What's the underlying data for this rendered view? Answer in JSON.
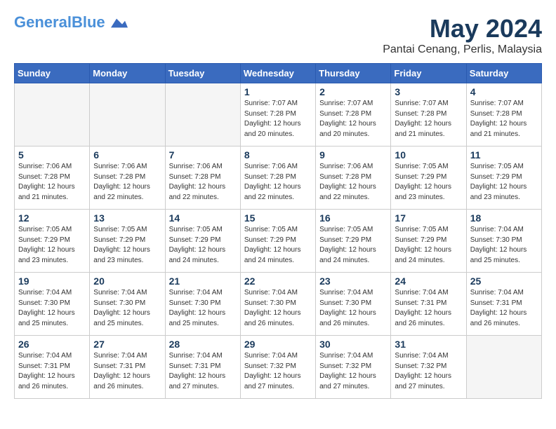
{
  "header": {
    "logo_line1": "General",
    "logo_line2": "Blue",
    "month": "May 2024",
    "location": "Pantai Cenang, Perlis, Malaysia"
  },
  "days_of_week": [
    "Sunday",
    "Monday",
    "Tuesday",
    "Wednesday",
    "Thursday",
    "Friday",
    "Saturday"
  ],
  "weeks": [
    [
      {
        "day": "",
        "sunrise": "",
        "sunset": "",
        "daylight": "",
        "empty": true
      },
      {
        "day": "",
        "sunrise": "",
        "sunset": "",
        "daylight": "",
        "empty": true
      },
      {
        "day": "",
        "sunrise": "",
        "sunset": "",
        "daylight": "",
        "empty": true
      },
      {
        "day": "1",
        "sunrise": "Sunrise: 7:07 AM",
        "sunset": "Sunset: 7:28 PM",
        "daylight": "Daylight: 12 hours and 20 minutes."
      },
      {
        "day": "2",
        "sunrise": "Sunrise: 7:07 AM",
        "sunset": "Sunset: 7:28 PM",
        "daylight": "Daylight: 12 hours and 20 minutes."
      },
      {
        "day": "3",
        "sunrise": "Sunrise: 7:07 AM",
        "sunset": "Sunset: 7:28 PM",
        "daylight": "Daylight: 12 hours and 21 minutes."
      },
      {
        "day": "4",
        "sunrise": "Sunrise: 7:07 AM",
        "sunset": "Sunset: 7:28 PM",
        "daylight": "Daylight: 12 hours and 21 minutes."
      }
    ],
    [
      {
        "day": "5",
        "sunrise": "Sunrise: 7:06 AM",
        "sunset": "Sunset: 7:28 PM",
        "daylight": "Daylight: 12 hours and 21 minutes."
      },
      {
        "day": "6",
        "sunrise": "Sunrise: 7:06 AM",
        "sunset": "Sunset: 7:28 PM",
        "daylight": "Daylight: 12 hours and 22 minutes."
      },
      {
        "day": "7",
        "sunrise": "Sunrise: 7:06 AM",
        "sunset": "Sunset: 7:28 PM",
        "daylight": "Daylight: 12 hours and 22 minutes."
      },
      {
        "day": "8",
        "sunrise": "Sunrise: 7:06 AM",
        "sunset": "Sunset: 7:28 PM",
        "daylight": "Daylight: 12 hours and 22 minutes."
      },
      {
        "day": "9",
        "sunrise": "Sunrise: 7:06 AM",
        "sunset": "Sunset: 7:28 PM",
        "daylight": "Daylight: 12 hours and 22 minutes."
      },
      {
        "day": "10",
        "sunrise": "Sunrise: 7:05 AM",
        "sunset": "Sunset: 7:29 PM",
        "daylight": "Daylight: 12 hours and 23 minutes."
      },
      {
        "day": "11",
        "sunrise": "Sunrise: 7:05 AM",
        "sunset": "Sunset: 7:29 PM",
        "daylight": "Daylight: 12 hours and 23 minutes."
      }
    ],
    [
      {
        "day": "12",
        "sunrise": "Sunrise: 7:05 AM",
        "sunset": "Sunset: 7:29 PM",
        "daylight": "Daylight: 12 hours and 23 minutes."
      },
      {
        "day": "13",
        "sunrise": "Sunrise: 7:05 AM",
        "sunset": "Sunset: 7:29 PM",
        "daylight": "Daylight: 12 hours and 23 minutes."
      },
      {
        "day": "14",
        "sunrise": "Sunrise: 7:05 AM",
        "sunset": "Sunset: 7:29 PM",
        "daylight": "Daylight: 12 hours and 24 minutes."
      },
      {
        "day": "15",
        "sunrise": "Sunrise: 7:05 AM",
        "sunset": "Sunset: 7:29 PM",
        "daylight": "Daylight: 12 hours and 24 minutes."
      },
      {
        "day": "16",
        "sunrise": "Sunrise: 7:05 AM",
        "sunset": "Sunset: 7:29 PM",
        "daylight": "Daylight: 12 hours and 24 minutes."
      },
      {
        "day": "17",
        "sunrise": "Sunrise: 7:05 AM",
        "sunset": "Sunset: 7:29 PM",
        "daylight": "Daylight: 12 hours and 24 minutes."
      },
      {
        "day": "18",
        "sunrise": "Sunrise: 7:04 AM",
        "sunset": "Sunset: 7:30 PM",
        "daylight": "Daylight: 12 hours and 25 minutes."
      }
    ],
    [
      {
        "day": "19",
        "sunrise": "Sunrise: 7:04 AM",
        "sunset": "Sunset: 7:30 PM",
        "daylight": "Daylight: 12 hours and 25 minutes."
      },
      {
        "day": "20",
        "sunrise": "Sunrise: 7:04 AM",
        "sunset": "Sunset: 7:30 PM",
        "daylight": "Daylight: 12 hours and 25 minutes."
      },
      {
        "day": "21",
        "sunrise": "Sunrise: 7:04 AM",
        "sunset": "Sunset: 7:30 PM",
        "daylight": "Daylight: 12 hours and 25 minutes."
      },
      {
        "day": "22",
        "sunrise": "Sunrise: 7:04 AM",
        "sunset": "Sunset: 7:30 PM",
        "daylight": "Daylight: 12 hours and 26 minutes."
      },
      {
        "day": "23",
        "sunrise": "Sunrise: 7:04 AM",
        "sunset": "Sunset: 7:30 PM",
        "daylight": "Daylight: 12 hours and 26 minutes."
      },
      {
        "day": "24",
        "sunrise": "Sunrise: 7:04 AM",
        "sunset": "Sunset: 7:31 PM",
        "daylight": "Daylight: 12 hours and 26 minutes."
      },
      {
        "day": "25",
        "sunrise": "Sunrise: 7:04 AM",
        "sunset": "Sunset: 7:31 PM",
        "daylight": "Daylight: 12 hours and 26 minutes."
      }
    ],
    [
      {
        "day": "26",
        "sunrise": "Sunrise: 7:04 AM",
        "sunset": "Sunset: 7:31 PM",
        "daylight": "Daylight: 12 hours and 26 minutes."
      },
      {
        "day": "27",
        "sunrise": "Sunrise: 7:04 AM",
        "sunset": "Sunset: 7:31 PM",
        "daylight": "Daylight: 12 hours and 26 minutes."
      },
      {
        "day": "28",
        "sunrise": "Sunrise: 7:04 AM",
        "sunset": "Sunset: 7:31 PM",
        "daylight": "Daylight: 12 hours and 27 minutes."
      },
      {
        "day": "29",
        "sunrise": "Sunrise: 7:04 AM",
        "sunset": "Sunset: 7:32 PM",
        "daylight": "Daylight: 12 hours and 27 minutes."
      },
      {
        "day": "30",
        "sunrise": "Sunrise: 7:04 AM",
        "sunset": "Sunset: 7:32 PM",
        "daylight": "Daylight: 12 hours and 27 minutes."
      },
      {
        "day": "31",
        "sunrise": "Sunrise: 7:04 AM",
        "sunset": "Sunset: 7:32 PM",
        "daylight": "Daylight: 12 hours and 27 minutes."
      },
      {
        "day": "",
        "sunrise": "",
        "sunset": "",
        "daylight": "",
        "empty": true
      }
    ]
  ]
}
